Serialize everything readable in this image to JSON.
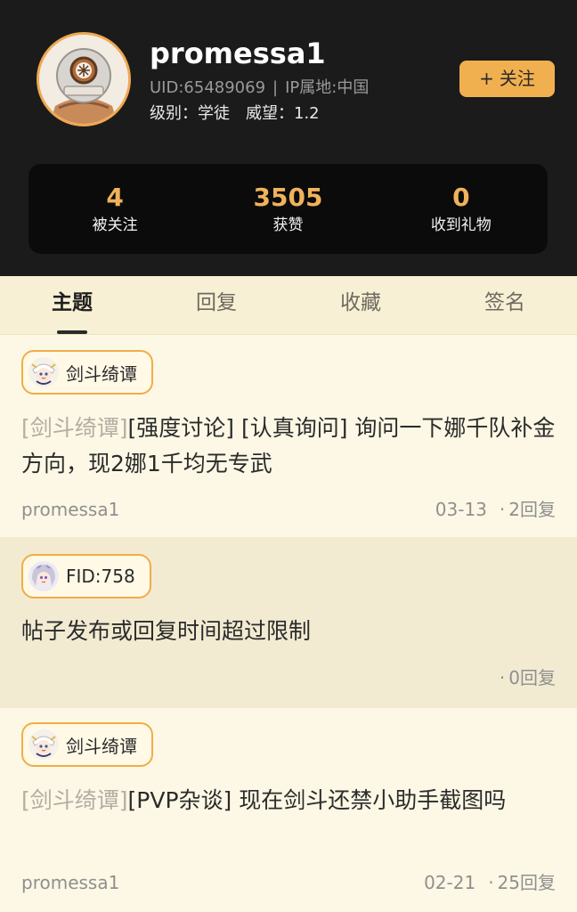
{
  "profile": {
    "username": "promessa1",
    "uid_text": "UID:65489069",
    "separator": "|",
    "ip_text": "IP属地:中国",
    "rank_text": "级别：学徒",
    "prestige_text": "威望：1.2",
    "follow_label": "关注",
    "follow_plus": "+"
  },
  "stats": [
    {
      "value": "4",
      "label": "被关注"
    },
    {
      "value": "3505",
      "label": "获赞"
    },
    {
      "value": "0",
      "label": "收到礼物"
    }
  ],
  "tabs": [
    {
      "label": "主题",
      "active": true
    },
    {
      "label": "回复",
      "active": false
    },
    {
      "label": "收藏",
      "active": false
    },
    {
      "label": "签名",
      "active": false
    }
  ],
  "posts": [
    {
      "forum": "剑斗绮谭",
      "prefix": "[剑斗绮谭]",
      "title": "[强度讨论] [认真询问] 询问一下娜千队补金方向，现2娜1千均无专武",
      "author": "promessa1",
      "date": "03-13",
      "dot": "·",
      "replies": "2回复"
    },
    {
      "forum": "FID:758",
      "prefix": "",
      "title": "帖子发布或回复时间超过限制",
      "author": "",
      "date": "",
      "dot": "·",
      "replies": "0回复"
    },
    {
      "forum": "剑斗绮谭",
      "prefix": "[剑斗绮谭]",
      "title": "[PVP杂谈] 现在剑斗还禁小助手截图吗",
      "author": "promessa1",
      "date": "02-21",
      "dot": "·",
      "replies": "25回复"
    }
  ],
  "colors": {
    "header_bg": "#1b1b1b",
    "accent": "#f1b04f",
    "stat_value": "#f0b25a",
    "page_bg": "#fdf8e5",
    "alt_bg": "#f2ebd2"
  },
  "icons": {
    "avatar": "diving-helmet-avatar",
    "forum_1": "paimon-chibi-icon",
    "forum_2": "silver-hair-chibi-icon",
    "forum_3": "paimon-chibi-icon"
  }
}
